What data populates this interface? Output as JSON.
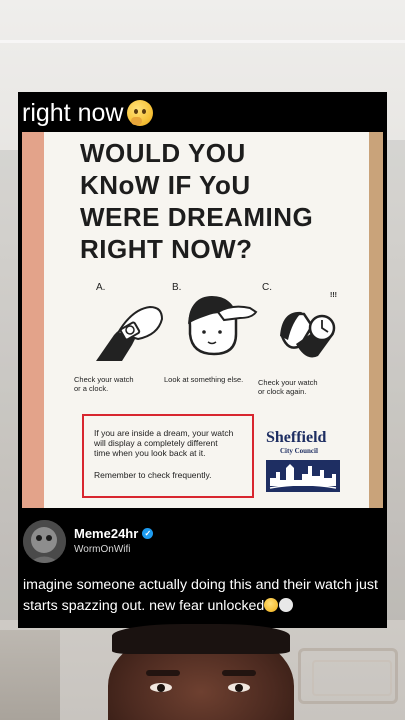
{
  "post": {
    "header_text": "right now",
    "header_emoji": "thinking-face-emoji"
  },
  "poster": {
    "title_lines": [
      "WOULD YOU",
      "KNoW IF YoU",
      "WERE DREAMING",
      "RIGHT NOW?"
    ],
    "steps": [
      {
        "label": "A.",
        "caption": "Check your watch\nor a clock."
      },
      {
        "label": "B.",
        "caption": "Look at something else."
      },
      {
        "label": "C.",
        "caption": "Check your watch\nor clock again."
      }
    ],
    "step_c_mark": "!!!",
    "notice_lines": [
      "If you are inside a dream, your watch",
      "will display a completely different",
      "time when you look back at it."
    ],
    "notice_reminder": "Remember to check frequently.",
    "council_name": "Sheffield",
    "council_sub": "City Council"
  },
  "account": {
    "name": "Meme24hr",
    "handle": "WormOnWifi",
    "verified": true,
    "verified_icon": "verified-badge-icon"
  },
  "caption": {
    "text": "imagine someone actually doing this and their watch just starts spazzing out. new fear unlocked",
    "emojis": [
      "sweat-smile-emoji",
      "skull-emoji"
    ]
  },
  "colors": {
    "card_bg": "#000000",
    "notice_border": "#d8262f",
    "council_blue": "#1e2e62",
    "verified_blue": "#1d9bf0"
  }
}
